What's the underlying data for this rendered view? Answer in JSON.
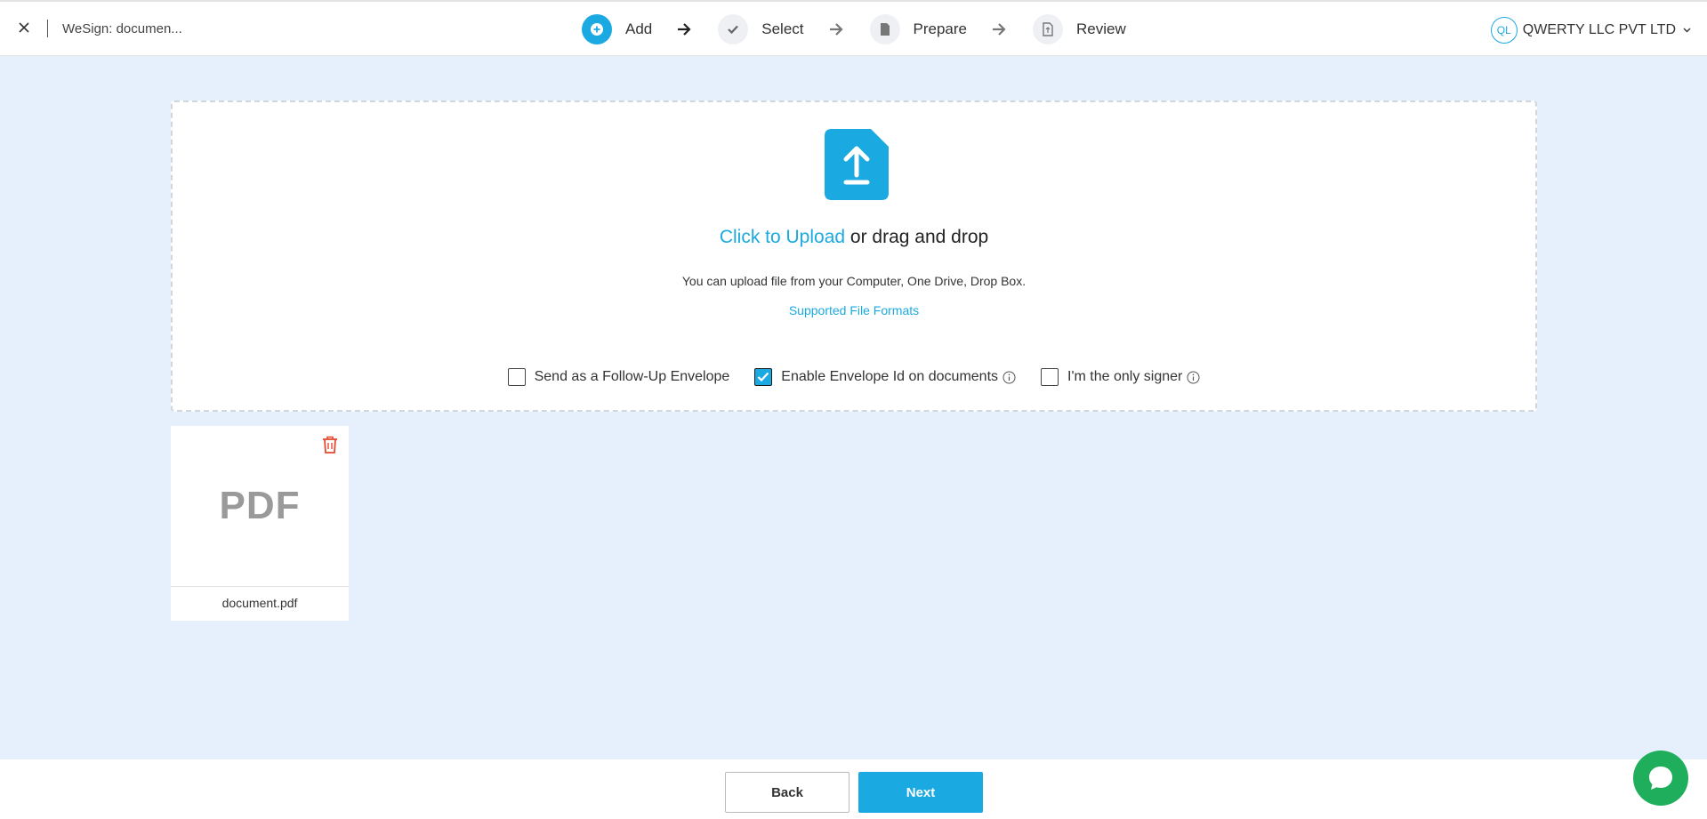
{
  "header": {
    "doc_title": "WeSign: documen...",
    "steps": [
      {
        "label": "Add",
        "state": "active",
        "icon": "plus-icon"
      },
      {
        "label": "Select",
        "state": "pending",
        "icon": "check-icon"
      },
      {
        "label": "Prepare",
        "state": "pending",
        "icon": "document-icon"
      },
      {
        "label": "Review",
        "state": "pending",
        "icon": "review-document-icon"
      }
    ],
    "org": {
      "initials": "QL",
      "name": "QWERTY LLC PVT LTD"
    }
  },
  "upload": {
    "link_text": "Click to Upload",
    "heading_rest": " or drag and drop",
    "subtitle": "You can upload file from your Computer, One Drive, Drop Box.",
    "formats_link": "Supported File Formats",
    "options": [
      {
        "label": "Send as a Follow-Up Envelope",
        "checked": false,
        "info": false
      },
      {
        "label": "Enable Envelope Id on documents",
        "checked": true,
        "info": true
      },
      {
        "label": "I'm the only signer",
        "checked": false,
        "info": true
      }
    ]
  },
  "files": [
    {
      "preview": "PDF",
      "name": "document.pdf"
    }
  ],
  "footer": {
    "back_label": "Back",
    "next_label": "Next"
  },
  "colors": {
    "accent": "#1ba9e1",
    "delete": "#e8472f",
    "chat": "#1fae5b",
    "background": "#e6f0fd"
  }
}
